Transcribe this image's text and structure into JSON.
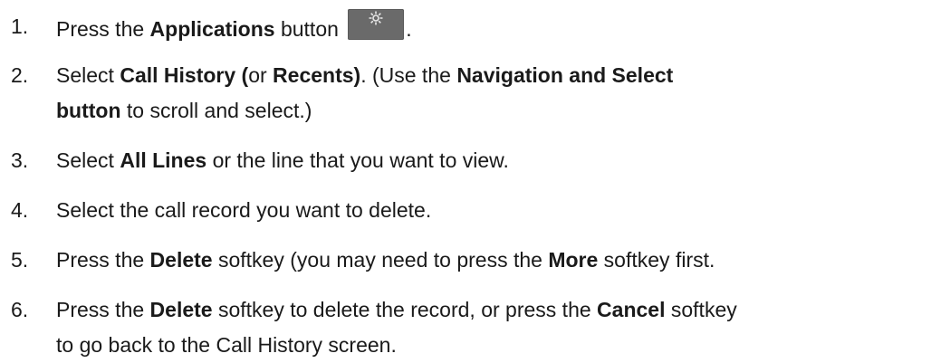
{
  "steps": [
    {
      "num": "1.",
      "segments": [
        {
          "t": "Press the ",
          "b": false
        },
        {
          "t": "Applications",
          "b": true
        },
        {
          "t": " button ",
          "b": false
        }
      ],
      "icon": "gear-icon",
      "after_icon": "."
    },
    {
      "num": "2.",
      "lines": [
        [
          {
            "t": "Select ",
            "b": false
          },
          {
            "t": "Call History (",
            "b": true
          },
          {
            "t": "or ",
            "b": false
          },
          {
            "t": "Recents)",
            "b": true
          },
          {
            "t": ". (Use the ",
            "b": false
          },
          {
            "t": "Navigation and Select",
            "b": true
          }
        ],
        [
          {
            "t": "button",
            "b": true
          },
          {
            "t": " to scroll and select.)",
            "b": false
          }
        ]
      ]
    },
    {
      "num": "3.",
      "segments": [
        {
          "t": "Select ",
          "b": false
        },
        {
          "t": "All Lines",
          "b": true
        },
        {
          "t": " or the line that you want to view.",
          "b": false
        }
      ]
    },
    {
      "num": "4.",
      "segments": [
        {
          "t": "Select the call record you want to delete.",
          "b": false
        }
      ]
    },
    {
      "num": "5.",
      "segments": [
        {
          "t": "Press the ",
          "b": false
        },
        {
          "t": "Delete",
          "b": true
        },
        {
          "t": " softkey (you may need to press the ",
          "b": false
        },
        {
          "t": "More",
          "b": true
        },
        {
          "t": " softkey first.",
          "b": false
        }
      ]
    },
    {
      "num": "6.",
      "lines": [
        [
          {
            "t": "Press the ",
            "b": false
          },
          {
            "t": "Delete",
            "b": true
          },
          {
            "t": " softkey to delete the record, or press the ",
            "b": false
          },
          {
            "t": "Cancel",
            "b": true
          },
          {
            "t": " softkey",
            "b": false
          }
        ],
        [
          {
            "t": "to go back to the Call History screen.",
            "b": false
          }
        ]
      ]
    }
  ],
  "colors": {
    "text": "#1a1a1a",
    "button_bg": "#6a6a6a",
    "icon": "#e8e8e8"
  }
}
